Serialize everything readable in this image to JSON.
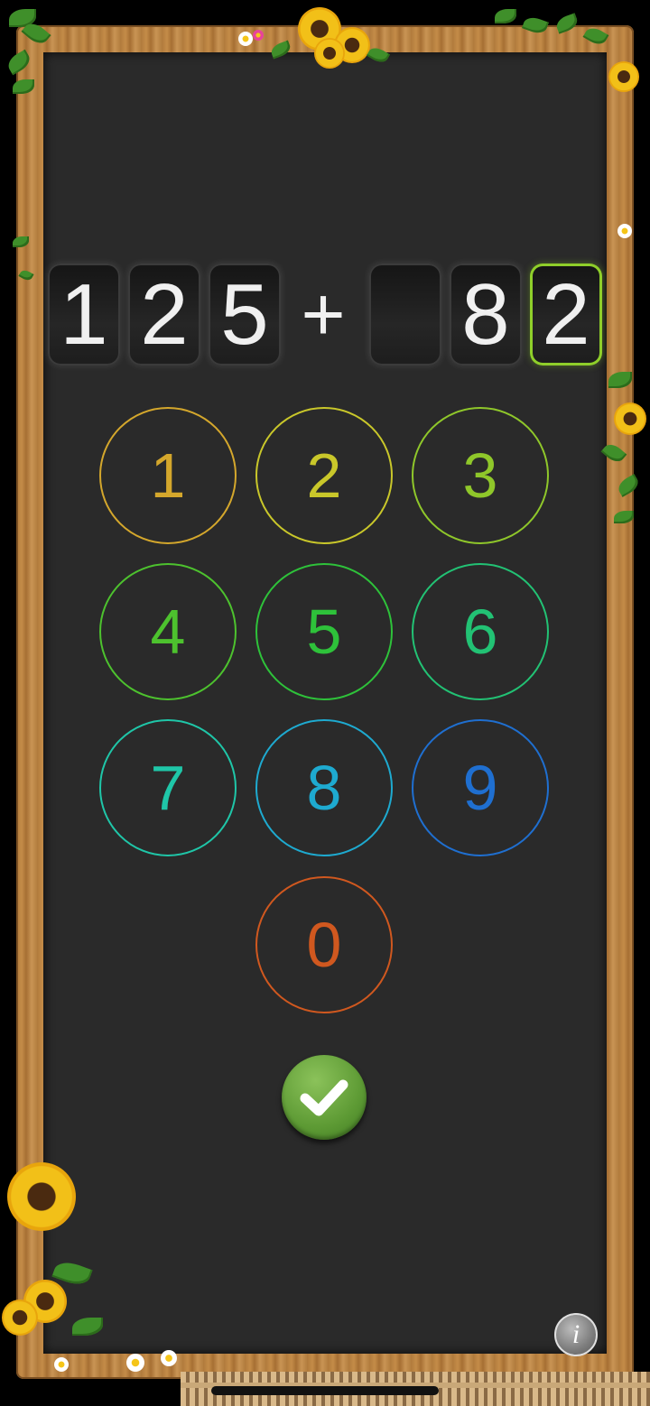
{
  "equation": {
    "left_digits": [
      "1",
      "2",
      "5"
    ],
    "operator": "+",
    "right_digits": [
      "",
      "8",
      "2"
    ]
  },
  "keypad": [
    {
      "label": "1",
      "color": "#d4a72c"
    },
    {
      "label": "2",
      "color": "#c9c72a"
    },
    {
      "label": "3",
      "color": "#8fc72a"
    },
    {
      "label": "4",
      "color": "#4dc22e"
    },
    {
      "label": "5",
      "color": "#2ec23a"
    },
    {
      "label": "6",
      "color": "#22c274"
    },
    {
      "label": "7",
      "color": "#1fc6a8"
    },
    {
      "label": "8",
      "color": "#1eaad0"
    },
    {
      "label": "9",
      "color": "#1f6fd0"
    },
    {
      "label": "0",
      "color": "#d0581f"
    }
  ],
  "submit_icon": "checkmark-icon",
  "info_label": "i"
}
